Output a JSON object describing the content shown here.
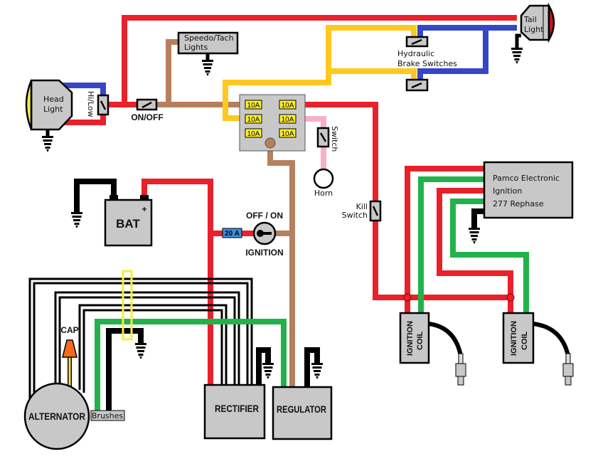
{
  "colors": {
    "red": "#e8212b",
    "blue": "#3546c8",
    "yellow": "#ffc81e",
    "brown": "#b5805e",
    "pink": "#f7b0c8",
    "green": "#22b24c",
    "gray": "#c8c8c8",
    "orange": "#f26a1b"
  },
  "components": {
    "head_light": [
      "Head",
      "Light"
    ],
    "hi_low": "Hi/Low",
    "on_off": "ON/OFF",
    "speedo": [
      "Speedo/Tach",
      "Lights"
    ],
    "tail_light": [
      "Tail",
      "Light"
    ],
    "brake_switches": [
      "Hydraulic",
      "Brake Switches"
    ],
    "fuses": [
      "10A",
      "10A",
      "10A",
      "10A",
      "10A",
      "10A"
    ],
    "horn_switch": "Switch",
    "horn": "Horn",
    "kill_switch": [
      "Kill",
      "Switch"
    ],
    "pamco": [
      "Pamco Electronic",
      "Ignition",
      "277 Rephase"
    ],
    "battery": "BAT",
    "battery_plus": "+",
    "main_fuse": "20 A",
    "ignition_off_on": "OFF / ON",
    "ignition": "IGNITION",
    "coil": [
      "IGNITION",
      "COIL"
    ],
    "cap": "CAP",
    "alternator": "ALTERNATOR",
    "brushes": "Brushes",
    "rectifier": "RECTIFIER",
    "regulator": "REGULATOR"
  }
}
